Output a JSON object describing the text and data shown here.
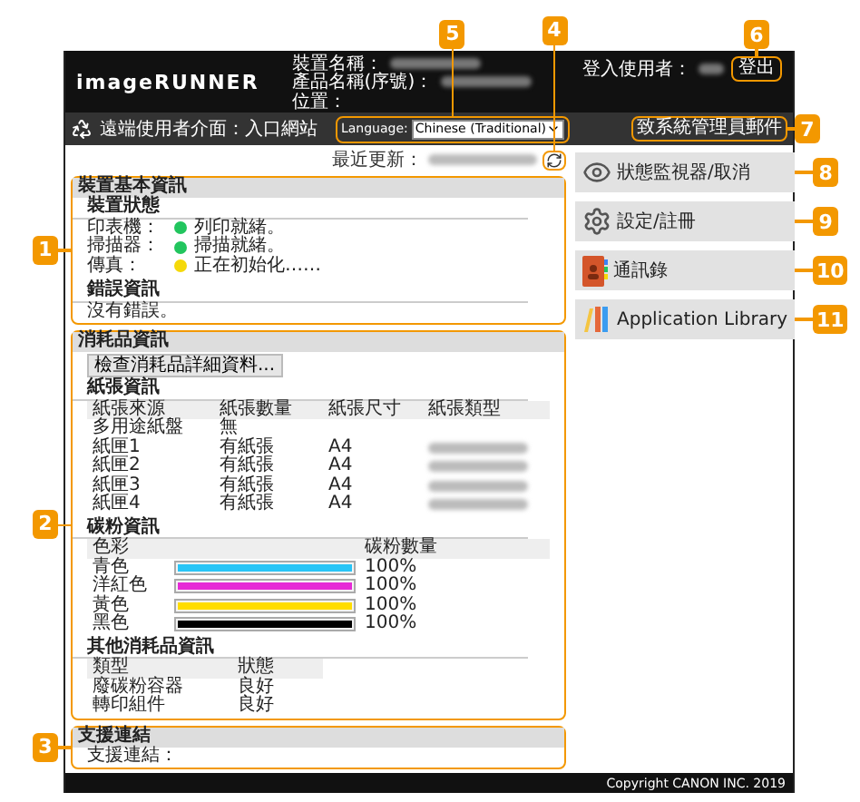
{
  "header": {
    "logo": "imageRUNNER",
    "device_fields": [
      {
        "label": "裝置名稱：",
        "value_blurred": true
      },
      {
        "label": "產品名稱(序號)：",
        "value_blurred": true
      },
      {
        "label": "位置：",
        "value_blurred": false
      }
    ],
    "login_label": "登入使用者：",
    "login_blurred": true,
    "logout_button": "登出",
    "logout_callout": "6"
  },
  "title_bar": {
    "title": "遠端使用者介面：入口網站",
    "language_label": "Language:",
    "language_value": "Chinese (Traditional)",
    "language_callout": "5",
    "mail_button": "致系統管理員郵件",
    "mail_callout": "7"
  },
  "last_updated": {
    "label": "最近更新：",
    "value_blurred": true,
    "refresh_callout": "4"
  },
  "device_info": {
    "title": "裝置基本資訊",
    "callout": "1",
    "status_heading": "裝置狀態",
    "statuses": [
      {
        "label": "印表機：",
        "text": "列印就緒。",
        "color": "#22c55e"
      },
      {
        "label": "掃描器：",
        "text": "掃描就緒。",
        "color": "#22c55e"
      },
      {
        "label": "傳真：",
        "text": "正在初始化……",
        "color": "#f5d90a"
      }
    ],
    "error_heading": "錯誤資訊",
    "error_text": "沒有錯誤。"
  },
  "consumables": {
    "title": "消耗品資訊",
    "callout": "2",
    "details_button": "檢查消耗品詳細資料...",
    "paper": {
      "heading": "紙張資訊",
      "columns": [
        "紙張來源",
        "紙張數量",
        "紙張尺寸",
        "紙張類型"
      ],
      "rows": [
        {
          "source": "多用途紙盤",
          "amount": "無",
          "type_blurred": false
        },
        {
          "source": "紙匣1",
          "amount": "有紙張",
          "size": "A4",
          "type_blurred": true
        },
        {
          "source": "紙匣2",
          "amount": "有紙張",
          "size": "A4",
          "type_blurred": true
        },
        {
          "source": "紙匣3",
          "amount": "有紙張",
          "size": "A4",
          "type_blurred": true
        },
        {
          "source": "紙匣4",
          "amount": "有紙張",
          "size": "A4",
          "type_blurred": true
        }
      ]
    },
    "toner": {
      "heading": "碳粉資訊",
      "columns": [
        "色彩",
        "碳粉數量"
      ],
      "rows": [
        {
          "name": "青色",
          "color": "#29c5f6",
          "level": 1,
          "reading": "100%"
        },
        {
          "name": "洋紅色",
          "color": "#e62ad6",
          "level": 1,
          "reading": "100%"
        },
        {
          "name": "黃色",
          "color": "#ffdd00",
          "level": 1,
          "reading": "100%"
        },
        {
          "name": "黑色",
          "color": "#000000",
          "level": 1,
          "reading": "100%"
        }
      ]
    },
    "other": {
      "heading": "其他消耗品資訊",
      "columns": [
        "類型",
        "狀態"
      ],
      "rows": [
        {
          "type": "廢碳粉容器",
          "status": "良好"
        },
        {
          "type": "轉印組件",
          "status": "良好"
        }
      ]
    }
  },
  "support": {
    "title": "支援連結",
    "callout": "3",
    "link_label": "支援連結："
  },
  "menu": [
    {
      "label": "狀態監視器/取消",
      "kind": "monitor",
      "callout": "8"
    },
    {
      "label": "設定/註冊",
      "kind": "settings",
      "callout": "9"
    },
    {
      "label": "通訊錄",
      "kind": "addressbook",
      "callout": "10"
    },
    {
      "label": "Application Library",
      "kind": "library",
      "callout": "11"
    }
  ],
  "footer": "Copyright CANON INC. 2019"
}
